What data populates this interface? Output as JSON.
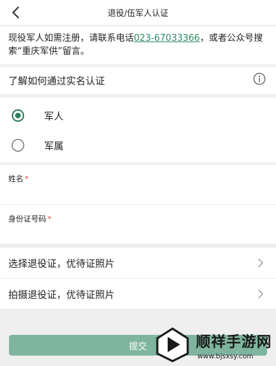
{
  "nav": {
    "title": "退役/伍军人认证"
  },
  "notice": {
    "text_before": "现役军人如需注册，请联系电话",
    "phone": "023-67033366",
    "text_after": "，或者公众号搜索“重庆军供”留言。"
  },
  "howto": {
    "label": "了解如何通过实名认证"
  },
  "identity": {
    "options": [
      {
        "label": "军人",
        "checked": true
      },
      {
        "label": "军属",
        "checked": false
      }
    ]
  },
  "form": {
    "name_label": "姓名",
    "id_label": "身份证号码",
    "required_mark": "*"
  },
  "uploads": [
    {
      "label": "选择退役证，优待证照片"
    },
    {
      "label": "拍摄退役证，优待证照片"
    }
  ],
  "submit": {
    "label": "提交"
  },
  "watermark": {
    "text": "顺祥手游网",
    "url": "www.bjsxsy.com"
  },
  "colors": {
    "accent": "#2e7d5b",
    "link": "#2e8b63",
    "submit_bg": "#7fb59e",
    "required": "#e03c3c"
  }
}
